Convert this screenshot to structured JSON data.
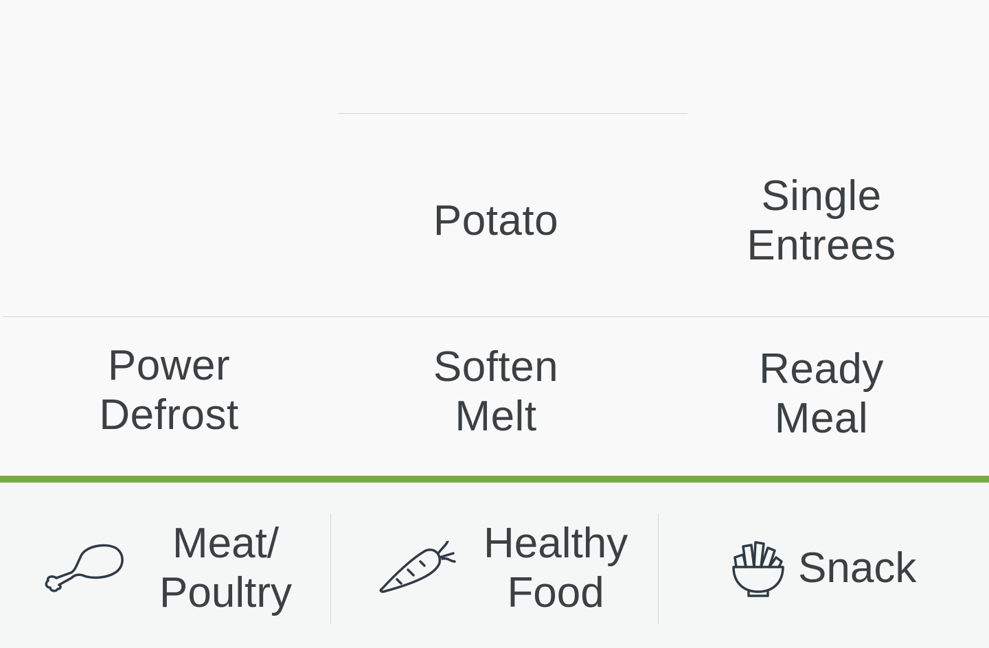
{
  "modes": {
    "potato": "Potato",
    "single_entrees": "Single\nEntrees",
    "power_defrost": "Power\nDefrost",
    "soften_melt": "Soften\nMelt",
    "ready_meal": "Ready\nMeal"
  },
  "categories": {
    "meat_poultry": {
      "label": "Meat/\nPoultry",
      "icon": "chicken-leg-icon"
    },
    "healthy_food": {
      "label": "Healthy\nFood",
      "icon": "carrot-icon"
    },
    "snack": {
      "label": "Snack",
      "icon": "snack-bowl-icon"
    }
  },
  "colors": {
    "accent": "#79ad41",
    "text": "#3c4043",
    "background": "#f9f9f9",
    "icon_stroke": "#2e3b44"
  }
}
